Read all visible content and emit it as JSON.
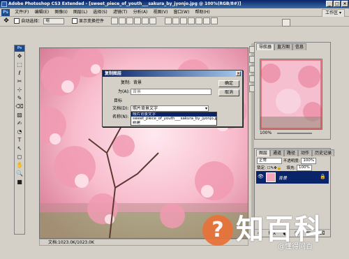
{
  "window": {
    "title": "Adobe Photoshop CS3 Extended - [sweet_piece_of_youth___sakura_by_jyonjo.jpg @ 100%(RGB/8#)]",
    "minimize": "_",
    "maximize": "□",
    "close": "×"
  },
  "menubar": {
    "logo": "Ps",
    "items": [
      "文件(F)",
      "编辑(E)",
      "图像(I)",
      "图层(L)",
      "选择(S)",
      "滤镜(T)",
      "分析(A)",
      "视图(V)",
      "窗口(W)",
      "帮助(H)"
    ],
    "workspace_label": "工作区 ▾"
  },
  "optionsbar": {
    "auto_select_label": "自动选择：",
    "auto_select_value": "组",
    "show_transform_label": "显示变换控件"
  },
  "toolbox": {
    "badge": "Ps",
    "tools": [
      "✥",
      "⬚",
      "ℓ",
      "✂",
      "⊹",
      "✎",
      "⌫",
      "▨",
      "✍",
      "◔",
      "T",
      "↖",
      "◻",
      "✋",
      "🔍",
      "■"
    ]
  },
  "dialog": {
    "title": "复制图层",
    "close": "×",
    "copy_label": "复制:",
    "copy_value": "背景",
    "as_label": "为(A):",
    "as_value": "背景",
    "target_label": "目标",
    "doc_label": "文档(D):",
    "doc_value": "照片背景文字",
    "name_label": "名称(N):",
    "ok_label": "确定",
    "cancel_label": "取消",
    "dropdown_options": [
      "照片背景文字",
      "sweet_piece_of_youth___sakura_by_jyonjo.jpg",
      "新建"
    ],
    "selected_option": "照片背景文字"
  },
  "status": {
    "doc_size": "文档:1023.0K/1023.0K"
  },
  "navigator": {
    "tabs": [
      "导航器",
      "直方图",
      "信息"
    ],
    "zoom": "100%"
  },
  "layers": {
    "tabs": [
      "图层",
      "通道",
      "路径",
      "动作",
      "历史记录"
    ],
    "blend_mode": "正常",
    "opacity_label": "不透明度:",
    "opacity_value": "100%",
    "lock_label": "锁定:",
    "fill_label": "填充:",
    "fill_value": "100%",
    "layer_name": "背景"
  },
  "watermark": {
    "main": "知百科",
    "sub": "@懂得问百"
  },
  "colors": {
    "accent": "#0a246a",
    "panel": "#d4d0c8",
    "canvas_pink": "#f4b8c8",
    "watermark_orange": "#e8733a"
  }
}
